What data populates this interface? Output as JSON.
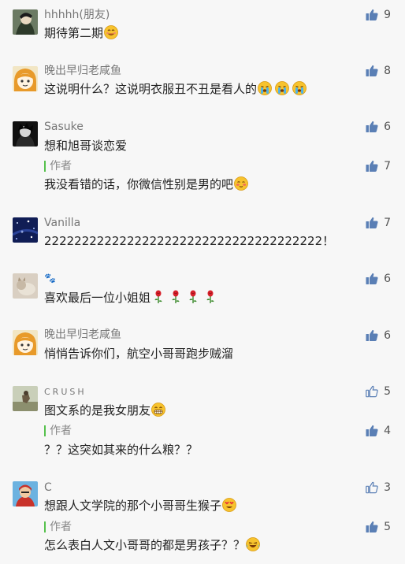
{
  "comments": [
    {
      "nickname": "hhhhh(朋友)",
      "text": "期待第二期",
      "likes": "9",
      "emoji": "smile"
    },
    {
      "nickname": "晚出早归老咸鱼",
      "text": "这说明什么？这说明衣服丑不丑是看人的",
      "likes": "8",
      "emoji": "cry"
    },
    {
      "nickname": "Sasuke",
      "text": "想和旭哥谈恋爱",
      "likes": "6",
      "reply": {
        "label": "作者",
        "text": "我没看错的话，你微信性别是男的吧",
        "likes": "7",
        "emoji": "blush"
      }
    },
    {
      "nickname": "Vanilla",
      "text": "2222222222222222222222222222222222222！",
      "likes": "7"
    },
    {
      "nickname": "🐾",
      "text": "喜欢最后一位小姐姐",
      "likes": "6",
      "emoji": "rose"
    },
    {
      "nickname": "晚出早归老咸鱼",
      "text": "悄悄告诉你们，航空小哥哥跑步贼溜",
      "likes": "6"
    },
    {
      "nickname": "CRUSH",
      "text": "图文系的是我女朋友",
      "likes": "5",
      "emoji": "grin",
      "reply": {
        "label": "作者",
        "text": "？？这突如其来的什么粮？？",
        "likes": "4"
      }
    },
    {
      "nickname": "C",
      "text": "想跟人文学院的那个小哥哥生猴子",
      "likes": "3",
      "emoji": "heart-eyes",
      "reply": {
        "label": "作者",
        "text": "怎么表白人文小哥哥的都是男孩子？？",
        "likes": "5",
        "emoji": "laugh"
      }
    }
  ],
  "colors": {
    "author_bar": "#55c14c",
    "like_filled": "#5a7fb5",
    "like_outline": "#5a7fb5"
  },
  "icons": {
    "like": "thumbs-up-icon"
  }
}
